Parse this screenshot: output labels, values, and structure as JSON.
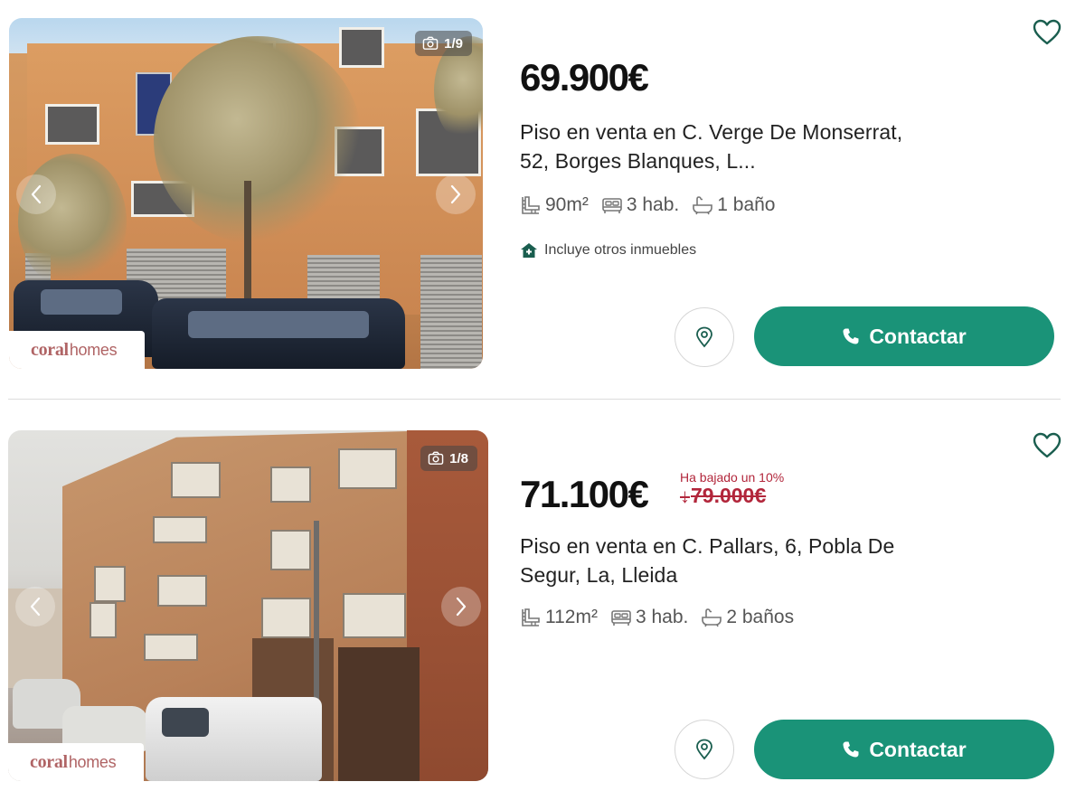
{
  "listings": [
    {
      "photo_counter": "1/9",
      "brand_part1": "coral",
      "brand_part2": "homes",
      "price": "69.900€",
      "title": "Piso en venta en C. Verge De Monserrat, 52, Borges Blanques, L...",
      "features": {
        "area": "90m²",
        "rooms": "3 hab.",
        "baths": "1 baño"
      },
      "extra": "Incluye otros inmuebles",
      "contact_label": "Contactar"
    },
    {
      "photo_counter": "1/8",
      "brand_part1": "coral",
      "brand_part2": "homes",
      "price": "71.100€",
      "price_drop_note": "Ha bajado un 10%",
      "price_old_arrow": "↓",
      "price_old": "79.000€",
      "title": "Piso en venta en C. Pallars, 6, Pobla De Segur, La, Lleida",
      "features": {
        "area": "112m²",
        "rooms": "3 hab.",
        "baths": "2 baños"
      },
      "contact_label": "Contactar"
    }
  ],
  "colors": {
    "accent": "#1a9378",
    "price_drop": "#b2263b",
    "brand": "#b06465"
  },
  "icons": [
    "camera-icon",
    "chevron-left-icon",
    "chevron-right-icon",
    "heart-icon",
    "area-icon",
    "bed-icon",
    "bath-icon",
    "house-plus-icon",
    "map-pin-icon",
    "phone-icon"
  ]
}
